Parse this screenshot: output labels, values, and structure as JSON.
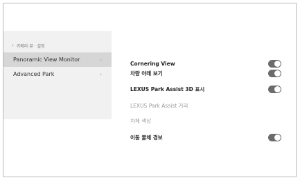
{
  "sidebar": {
    "back_label": "카메라 뷰 · 설정",
    "items": [
      {
        "label": "Panoramic View Monitor",
        "chevron": "›",
        "selected": true
      },
      {
        "label": "Advanced Park",
        "chevron": "›",
        "selected": false
      }
    ]
  },
  "settings": {
    "rows": [
      {
        "label": "Cornering View",
        "toggle": "on"
      },
      {
        "label": "차량 아래 보기",
        "toggle": "on"
      },
      {
        "label": "LEXUS Park Assist 3D 표시",
        "toggle": "on"
      },
      {
        "label": "LEXUS Park Assist 거리",
        "toggle": null
      },
      {
        "label": "차체 색상",
        "toggle": null
      },
      {
        "label": "이동 물체 경보",
        "toggle": "on"
      }
    ]
  },
  "colors": {
    "sidebar_bg": "#f1f1f1",
    "selected_bg": "#d6d6d6",
    "toggle_on": "#6b6b6b"
  }
}
